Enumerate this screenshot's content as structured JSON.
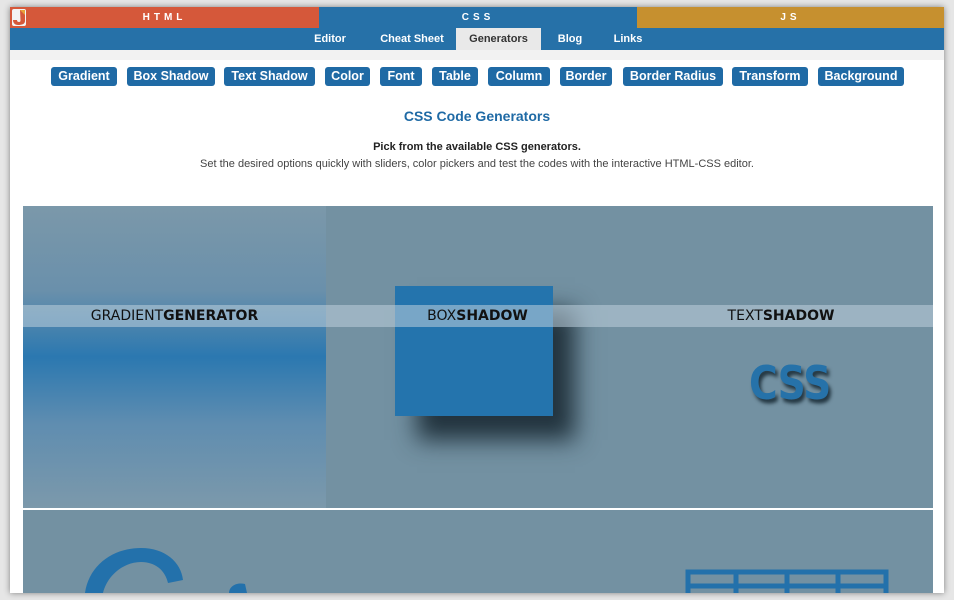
{
  "lang_tabs": [
    {
      "label": "HTML"
    },
    {
      "label": "CSS"
    },
    {
      "label": "JS"
    }
  ],
  "subnav": [
    {
      "label": "Editor",
      "active": false
    },
    {
      "label": "Cheat Sheet",
      "active": false
    },
    {
      "label": "Generators",
      "active": true
    },
    {
      "label": "Blog",
      "active": false
    },
    {
      "label": "Links",
      "active": false
    }
  ],
  "generator_buttons": [
    "Gradient",
    "Box Shadow",
    "Text Shadow",
    "Color",
    "Font",
    "Table",
    "Column",
    "Border",
    "Border Radius",
    "Transform",
    "Background"
  ],
  "page": {
    "title": "CSS Code Generators",
    "subtitle": "Pick from the available CSS generators.",
    "description": "Set the desired options quickly with sliders, color pickers and test the codes with the interactive HTML-CSS editor."
  },
  "tiles": [
    {
      "light": "GRADIENT",
      "bold": "GENERATOR"
    },
    {
      "light": "BOX",
      "bold": "SHADOW"
    },
    {
      "light": "TEXT",
      "bold": "SHADOW"
    }
  ],
  "sample_text": "CSS",
  "colors": {
    "html_tab": "#d5583a",
    "css_tab": "#2671a8",
    "js_tab": "#c6902f",
    "accent": "#1f6aa5",
    "showcase_bg": "#7391a2"
  },
  "icons": {
    "logo": "site-logo-icon"
  }
}
